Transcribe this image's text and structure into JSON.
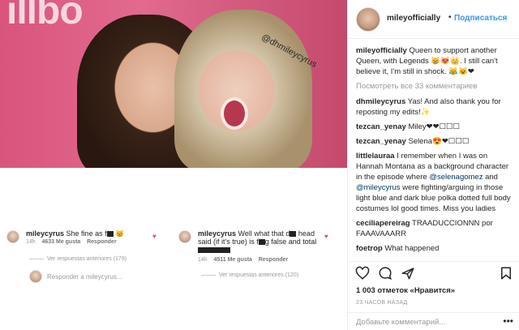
{
  "photo": {
    "backdrop_text": "illbo",
    "watermark": "@dhmileycyrus"
  },
  "screenshot": {
    "comment1": {
      "username": "mileycyrus",
      "text_before": "She  fine as f",
      "time": "14h",
      "likes": "4633 Me gusta",
      "reply_label": "Responder",
      "view_replies": "Ver respuestas anteriores (179)"
    },
    "comment2": {
      "username": "mileycyrus",
      "line1_a": "Well what that d",
      "line1_b": " head",
      "line2_a": "said (if it's true) is f",
      "line2_b": "g false and",
      "line3": "total",
      "time": "14h",
      "likes": "4511 Me gusta",
      "reply_label": "Responder",
      "view_replies": "Ver respuestas anteriores (120)"
    },
    "reply_placeholder": "Responder a mileycyrus..."
  },
  "header": {
    "username": "mileyofficially",
    "dot": "•",
    "follow_label": "Подписаться"
  },
  "comments": {
    "caption_user": "mileyofficially",
    "caption_text": "Queen to support another Queen, with Legends 😸😻👑. I still can't believe it, I'm still in shock. 😹😺❤",
    "view_all": "Посмотреть все 33 комментариев",
    "items": [
      {
        "user": "dhmileycyrus",
        "text": "Yas! And also thank you for reposting my edits!✨"
      },
      {
        "user": "tezcan_yenay",
        "text": "Miley❤❤☐☐☐"
      },
      {
        "user": "tezcan_yenay",
        "text": "Selena😍❤☐☐☐"
      },
      {
        "user": "littlelauraa",
        "text_a": "I remember when I was on Hannah Montana as a background character in the episode where ",
        "mention1": "@selenagomez",
        "text_b": " and ",
        "mention2": "@mileycyrus",
        "text_c": " were fighting/arguing in those light blue and dark blue polka dotted full body costumes lol good times. Miss you ladies"
      },
      {
        "user": "ceciliapereirag",
        "text": "TRAADUCCIONNN por FAAAVAAARR"
      },
      {
        "user": "foetrop",
        "text": "What happened"
      }
    ]
  },
  "actions": {
    "likes": "1 003 отметок «Нравится»",
    "time": "23 ЧАСОВ НАЗАД",
    "add_comment_placeholder": "Добавьте комментарий...",
    "more_icon": "more-dots-icon"
  },
  "colors": {
    "accent": "#3897f0",
    "like_red": "#ed4956",
    "muted": "#999999"
  }
}
